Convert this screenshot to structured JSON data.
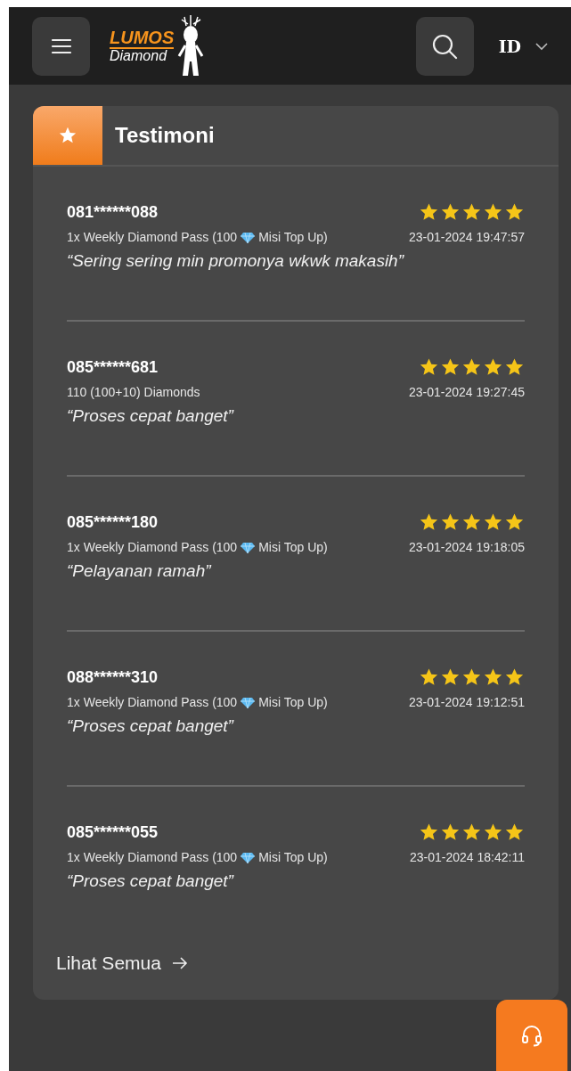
{
  "header": {
    "logo_top": "LUMOS",
    "logo_bottom": "Diamond",
    "language": "ID"
  },
  "section": {
    "title": "Testimoni"
  },
  "testimonials": [
    {
      "phone": "081******088",
      "stars": 5,
      "product_parts": [
        "1x Weekly Diamond Pass (100",
        "Misi Top Up)"
      ],
      "date": "23-01-2024 19:47:57",
      "comment": "“Sering sering min promonya wkwk makasih”"
    },
    {
      "phone": "085******681",
      "stars": 5,
      "product_parts": [
        "110 (100+10) Diamonds"
      ],
      "date": "23-01-2024 19:27:45",
      "comment": "“Proses cepat banget”"
    },
    {
      "phone": "085******180",
      "stars": 5,
      "product_parts": [
        "1x Weekly Diamond Pass (100",
        "Misi Top Up)"
      ],
      "date": "23-01-2024 19:18:05",
      "comment": "“Pelayanan ramah”"
    },
    {
      "phone": "088******310",
      "stars": 5,
      "product_parts": [
        "1x Weekly Diamond Pass (100",
        "Misi Top Up)"
      ],
      "date": "23-01-2024 19:12:51",
      "comment": "“Proses cepat banget”"
    },
    {
      "phone": "085******055",
      "stars": 5,
      "product_parts": [
        "1x Weekly Diamond Pass (100",
        "Misi Top Up)"
      ],
      "date": "23-01-2024 18:42:11",
      "comment": "“Proses cepat banget”"
    }
  ],
  "see_all": "Lihat Semua"
}
